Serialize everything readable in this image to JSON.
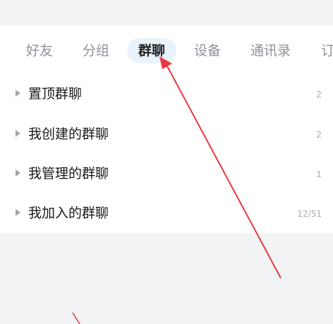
{
  "tabs": [
    {
      "label": "好友",
      "active": false
    },
    {
      "label": "分组",
      "active": false
    },
    {
      "label": "群聊",
      "active": true
    },
    {
      "label": "设备",
      "active": false
    },
    {
      "label": "通讯录",
      "active": false
    },
    {
      "label": "订",
      "active": false
    }
  ],
  "groups": [
    {
      "label": "置顶群聊",
      "count": "2"
    },
    {
      "label": "我创建的群聊",
      "count": "2"
    },
    {
      "label": "我管理的群聊",
      "count": "1"
    },
    {
      "label": "我加入的群聊",
      "count": "12/51"
    }
  ],
  "colors": {
    "accent_tab_bg": "#e8f3fb",
    "annotation_arrow": "#e8383d"
  },
  "icons": {
    "expand": "caret-right-icon"
  }
}
